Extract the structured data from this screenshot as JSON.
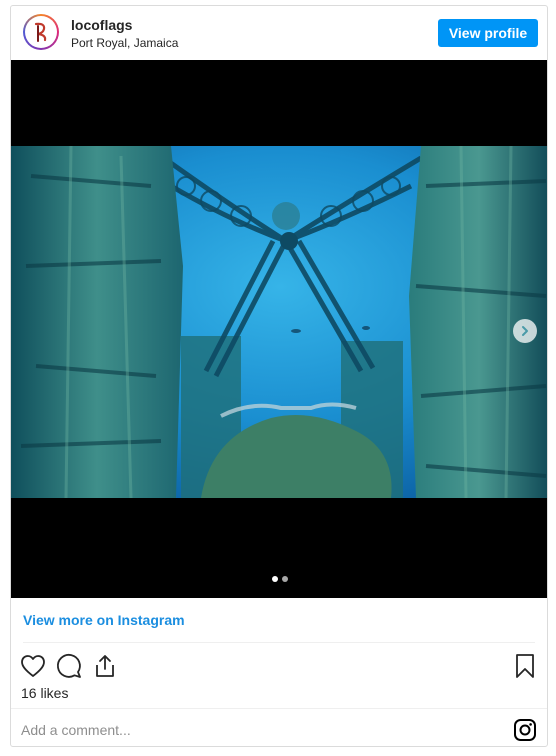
{
  "header": {
    "username": "locoflags",
    "location": "Port Royal, Jamaica",
    "view_profile_label": "View profile"
  },
  "icons": {
    "avatar": "flag-logo",
    "next": "chevron-right-icon",
    "like": "heart-icon",
    "comment": "comment-bubble-icon",
    "share": "share-icon",
    "save": "bookmark-icon",
    "brand": "instagram-icon"
  },
  "carousel": {
    "current_slide": 1,
    "total_slides": 2
  },
  "footer": {
    "view_more_label": "View more on Instagram",
    "likes": "16 likes",
    "comment_placeholder": "Add a comment..."
  },
  "colors": {
    "accent": "#0095f6",
    "link": "#1b8ee0"
  }
}
